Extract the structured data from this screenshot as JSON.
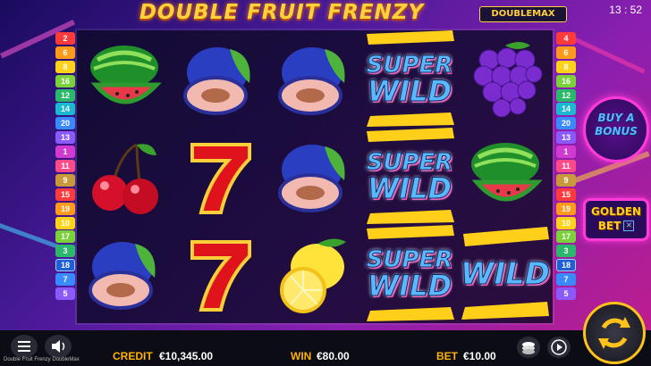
{
  "game": {
    "title": "DOUBLE FRUIT FRENZY",
    "logo": "DOUBLEMAX",
    "footer_name": "Double Fruit Frenzy DoubleMax"
  },
  "status": {
    "clock": "13 : 52"
  },
  "paylines": {
    "left": [
      "2",
      "6",
      "8",
      "16",
      "12",
      "14",
      "20",
      "13",
      "1",
      "11",
      "9",
      "15",
      "19",
      "10",
      "17",
      "3",
      "18",
      "7",
      "5"
    ],
    "right": [
      "4",
      "6",
      "8",
      "16",
      "12",
      "14",
      "20",
      "13",
      "1",
      "11",
      "9",
      "15",
      "19",
      "10",
      "17",
      "3",
      "18",
      "7",
      "5"
    ],
    "active": "18"
  },
  "reels": {
    "symbols": [
      [
        "watermelon-icon",
        "cherries-icon",
        "plum-icon"
      ],
      [
        "plum-icon",
        "seven-icon",
        "seven-icon"
      ],
      [
        "plum-icon",
        "plum-icon",
        "lemon-icon"
      ],
      [
        "super-wild",
        "super-wild",
        "super-wild"
      ],
      [
        "grapes-icon",
        "watermelon-icon",
        "wild"
      ]
    ],
    "super_wild_top": "SUPER",
    "super_wild_bottom": "WILD",
    "wild_label": "WILD"
  },
  "side_buttons": {
    "buy_bonus_line1": "BUY A",
    "buy_bonus_line2": "BONUS",
    "golden_bet_line1": "GOLDEN",
    "golden_bet_line2": "BET"
  },
  "hud": {
    "credit_label": "CREDIT",
    "credit_value": "€10,345.00",
    "win_label": "WIN",
    "win_value": "€80.00",
    "bet_label": "BET",
    "bet_value": "€10.00"
  },
  "colors": {
    "accent_gold": "#ffc21a",
    "hud_label": "#ffb300",
    "payline_active": "#1f5fd6"
  }
}
